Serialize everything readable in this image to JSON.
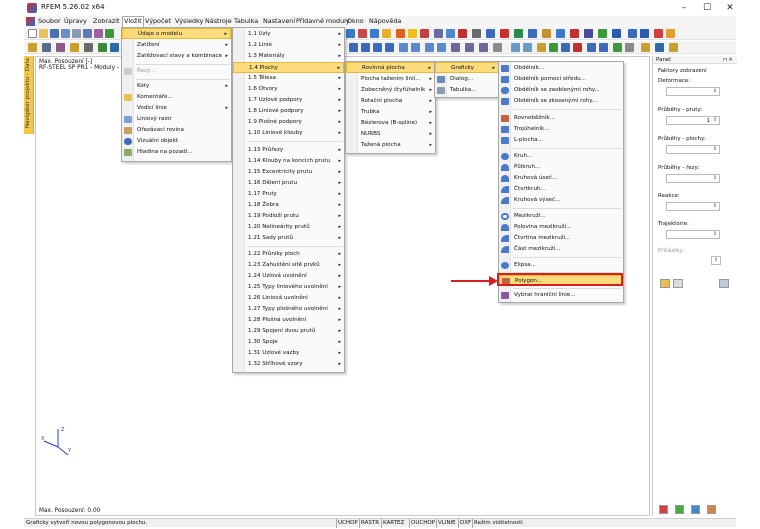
{
  "window": {
    "title": "RFEM 5.26.02 x64",
    "min": "–",
    "max": "☐",
    "close": "✕"
  },
  "menubar": [
    "Soubor",
    "Úpravy",
    "Zobrazit",
    "Vložit",
    "Výpočet",
    "Výsledky",
    "Nástroje",
    "Tabulka",
    "Nastavení",
    "Přídavné moduly",
    "Okno",
    "Nápověda"
  ],
  "navtabs": [
    "Navigátor projektu - Data"
  ],
  "info": {
    "line1": "Max. Posouzení [-]",
    "line2": "RF-STEEL SP PR1 - Moduly - stou...",
    "bottom": "Max. Posouzení: 0.00"
  },
  "menu1": {
    "items": [
      "Údaje o modelu",
      "Zatížení",
      "Zatěžovací stavy a kombinace",
      "Řezy...",
      "Kóty",
      "Komentáře...",
      "Vodicí linie",
      "Liniový rastr",
      "Ořezávací rovina",
      "Vizuální objekt",
      "Hladina na pozadí..."
    ]
  },
  "menu2": {
    "items": [
      "1.1 Uzly",
      "1.2 Linie",
      "1.3 Materiály",
      "1.4 Plochy",
      "1.5 Tělesa",
      "1.6 Otvory",
      "1.7 Uzlové podpory",
      "1.8 Liniové podpory",
      "1.9 Plošné podpory",
      "1.10 Liniové klouby",
      "1.13 Průřezy",
      "1.14 Klouby na koncích prutu",
      "1.15 Excentricity prutu",
      "1.16 Dělení prutu",
      "1.17 Pruty",
      "1.18 Žebra",
      "1.19 Podloží prutu",
      "1.20 Nelineárity prutů",
      "1.21 Sady prutů",
      "1.22 Průniky ploch",
      "1.23 Zahuštění sítě prvků",
      "1.24 Uzlová uvolnění",
      "1.25 Typy liniového uvolnění",
      "1.26 Liniová uvolnění",
      "1.27 Typy plošného uvolnění",
      "1.28 Plošná uvolnění",
      "1.29 Spojení dvou prutů",
      "1.30 Spoje",
      "1.31 Uzlové vazby",
      "1.32 Stříhové vzory"
    ]
  },
  "menu3": {
    "items": [
      "Rovinná plocha",
      "Plocha tažením linií...",
      "Zobecněný čtyřúhelník",
      "Rotační plocha",
      "Trubka",
      "Bézierova (B-spline)",
      "NURBS",
      "Tažená plocha"
    ]
  },
  "menu4": {
    "items": [
      "Graficky",
      "Dialog...",
      "Tabulka..."
    ]
  },
  "menu5": {
    "items": [
      "Obdélník...",
      "Obdélník pomocí středu...",
      "Obdélník se zaoblenými rohy...",
      "Obdélník se zkosenými rohy...",
      "Rovnoběžník...",
      "Trojúhelník...",
      "L-plocha...",
      "Kruh...",
      "Půlkruh...",
      "Kruhová úseč...",
      "Čtvrtkruh...",
      "Kruhová výseč...",
      "Mezikruží...",
      "Polovina mezikruží...",
      "Čtvrtina mezikruží...",
      "Část mezikruží...",
      "Elipsa...",
      "Polygon...",
      "Vybrat hraniční linie..."
    ]
  },
  "panel": {
    "title": "Panel",
    "pin": "⊓ ✕",
    "faktory": "Faktory zobrazení",
    "deformace": "Deformace:",
    "pruty": "Průběhy - pruty:",
    "pruty_val": "1",
    "plochy": "Průběhy - plochy:",
    "rezy": "Průběhy - řezy:",
    "reakce": "Reakce:",
    "trajektorie": "Trajektorie:",
    "prisobky": "Příčástky:"
  },
  "status": {
    "text": "Graficky vytvoří novou polygonovou plochu.",
    "buttons": [
      "UCHOP",
      "RASTR",
      "KARTEZ",
      "OUCHOP",
      "VLINIE",
      "DXF",
      "Režim viditelnosti"
    ]
  },
  "colors": {
    "highlight": "#fbdb7c",
    "accent_red": "#d62020"
  }
}
